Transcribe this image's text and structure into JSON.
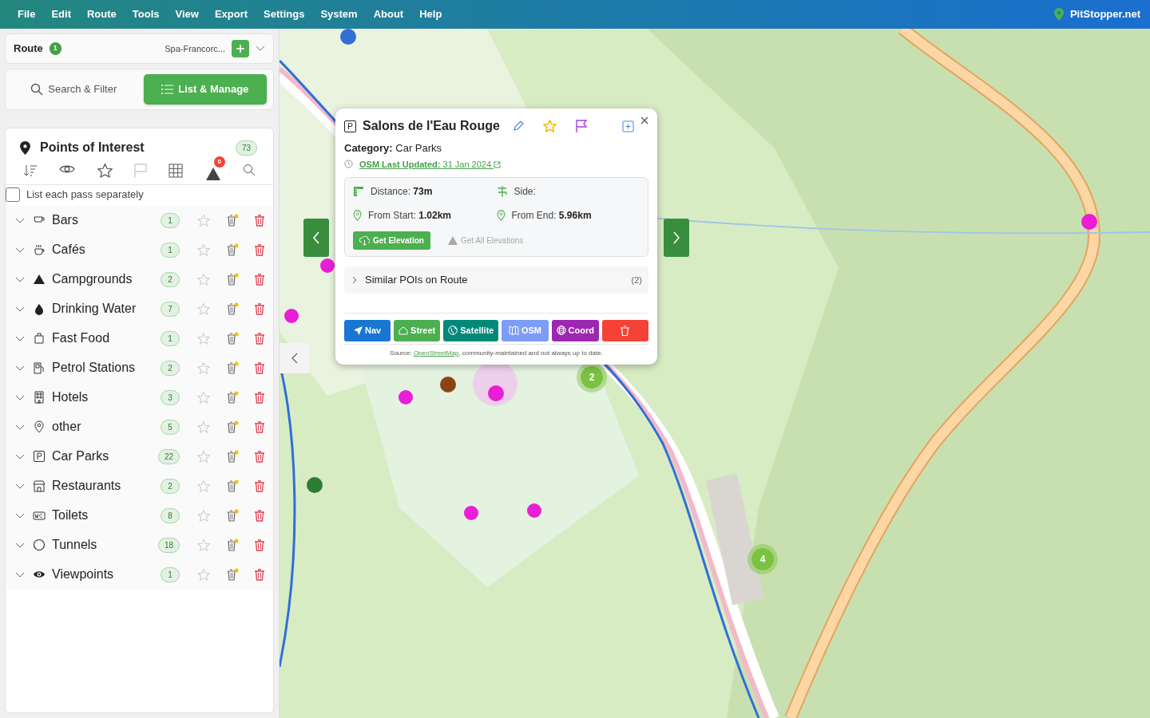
{
  "menu": [
    {
      "label": "File"
    },
    {
      "label": "Edit"
    },
    {
      "label": "Route"
    },
    {
      "label": "Tools"
    },
    {
      "label": "View"
    },
    {
      "label": "Export"
    },
    {
      "label": "Settings"
    },
    {
      "label": "System"
    },
    {
      "label": "About"
    },
    {
      "label": "Help"
    }
  ],
  "brand": "PitStopper.net",
  "route": {
    "label": "Route",
    "count": "1",
    "name": "Spa-Francorc..."
  },
  "tabs": [
    {
      "label": "Search & Filter",
      "kind": "search",
      "selected": false
    },
    {
      "label": "List & Manage",
      "kind": "list",
      "selected": true
    }
  ],
  "poi": {
    "title": "Points of Interest",
    "count": "73",
    "alert_count": "0",
    "list_each_pass": {
      "label": "List each pass separately",
      "checked": false
    },
    "categories": [
      {
        "name": "Bars",
        "count": "1",
        "kind": "bar",
        "expanded": false
      },
      {
        "name": "Cafés",
        "count": "1",
        "kind": "cafe",
        "expanded": false
      },
      {
        "name": "Campgrounds",
        "count": "2",
        "kind": "camp",
        "expanded": false
      },
      {
        "name": "Drinking Water",
        "count": "7",
        "kind": "water",
        "expanded": false
      },
      {
        "name": "Fast Food",
        "count": "1",
        "kind": "bag",
        "expanded": false
      },
      {
        "name": "Petrol Stations",
        "count": "2",
        "kind": "fuel",
        "expanded": false
      },
      {
        "name": "Hotels",
        "count": "3",
        "kind": "hotel",
        "expanded": false
      },
      {
        "name": "other",
        "count": "5",
        "kind": "pin",
        "expanded": false
      },
      {
        "name": "Car Parks",
        "count": "22",
        "kind": "parking",
        "expanded": false
      },
      {
        "name": "Restaurants",
        "count": "2",
        "kind": "shop",
        "expanded": false
      },
      {
        "name": "Toilets",
        "count": "8",
        "kind": "wc",
        "expanded": false
      },
      {
        "name": "Tunnels",
        "count": "18",
        "kind": "circle",
        "expanded": false
      },
      {
        "name": "Viewpoints",
        "count": "1",
        "kind": "eye",
        "expanded": false
      }
    ]
  },
  "popup": {
    "sign": "P",
    "title": "Salons de l'Eau Rouge",
    "category_label": "Category:",
    "category": "Car Parks",
    "updated_label": "OSM Last Updated:",
    "updated_date": "31 Jan 2024",
    "stats": [
      {
        "label": "Distance:",
        "value": "73m",
        "kind": "ruler"
      },
      {
        "label": "Side:",
        "kind": "sign"
      },
      {
        "label": "From Start:",
        "value": "1.02km",
        "kind": "pin"
      },
      {
        "label": "From End:",
        "value": "5.96km",
        "kind": "pin"
      }
    ],
    "elevation": "Get Elevation",
    "all_elevations": {
      "label": "Get All Elevations",
      "disabled": true
    },
    "similar": {
      "label": "Similar POIs on Route",
      "count": "(2)",
      "expanded": false
    },
    "actions": [
      {
        "label": "Nav",
        "kind": "nav",
        "color": "#1976d2"
      },
      {
        "label": "Street",
        "kind": "street",
        "color": "#4caf50"
      },
      {
        "label": "Satellite",
        "kind": "satellite",
        "color": "#00897b"
      },
      {
        "label": "OSM",
        "kind": "osm",
        "color": "#7c9cf5"
      },
      {
        "label": "Coord",
        "kind": "coord",
        "color": "#9c27b0"
      },
      {
        "kind": "delete",
        "color": "#f44336"
      }
    ],
    "source_prefix": "Source: ",
    "source_link": "OpenStreetMap",
    "source_suffix": ", community-maintained and not always up to date."
  },
  "clusters": [
    {
      "count": "2"
    },
    {
      "count": "4"
    }
  ]
}
